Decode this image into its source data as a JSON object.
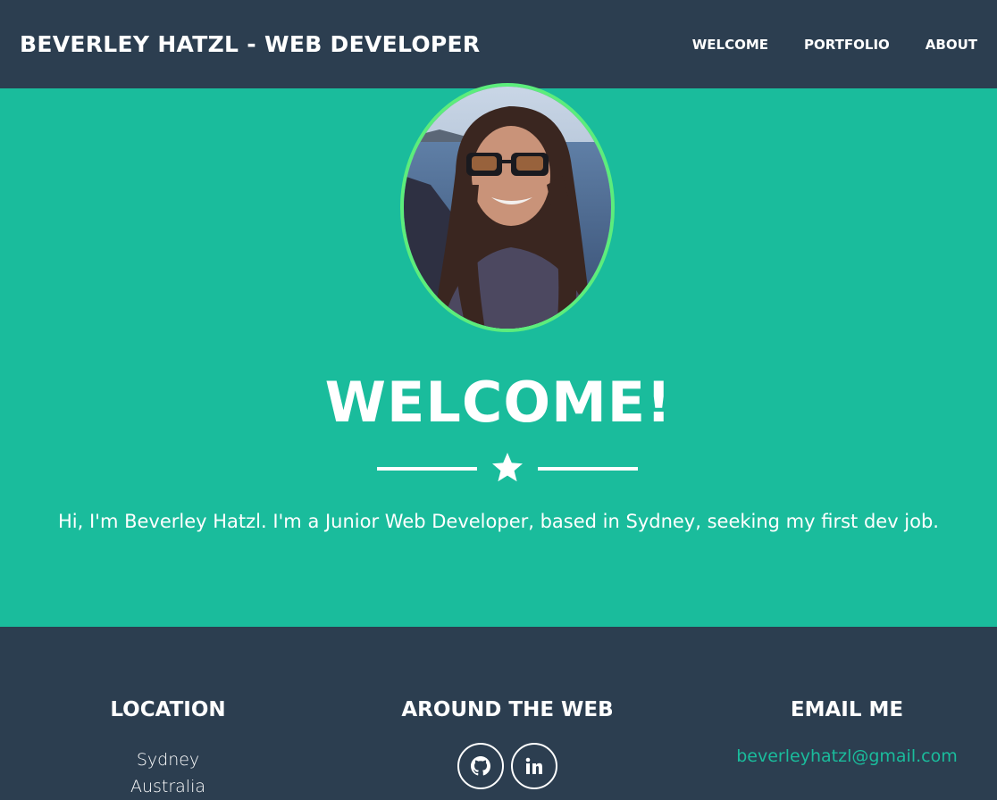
{
  "navbar": {
    "brand": "BEVERLEY HATZL - WEB DEVELOPER",
    "links": [
      "WELCOME",
      "PORTFOLIO",
      "ABOUT"
    ]
  },
  "masthead": {
    "avatar_icon": "profile-photo",
    "title": "WELCOME!",
    "divider_icon": "star-icon",
    "intro": "Hi, I'm Beverley Hatzl. I'm a Junior Web Developer, based in Sydney, seeking my first dev job."
  },
  "footer": {
    "location": {
      "heading": "LOCATION",
      "lines": [
        "Sydney",
        "Australia"
      ]
    },
    "web": {
      "heading": "AROUND THE WEB",
      "icons": [
        "github-icon",
        "linkedin-icon"
      ]
    },
    "email": {
      "heading": "EMAIL ME",
      "address": "beverleyhatzl@gmail.com"
    }
  },
  "colors": {
    "nav_bg": "#2c3e50",
    "masthead_bg": "#1abc9c",
    "avatar_border": "#5ced7c",
    "email_link": "#1abc9c"
  }
}
